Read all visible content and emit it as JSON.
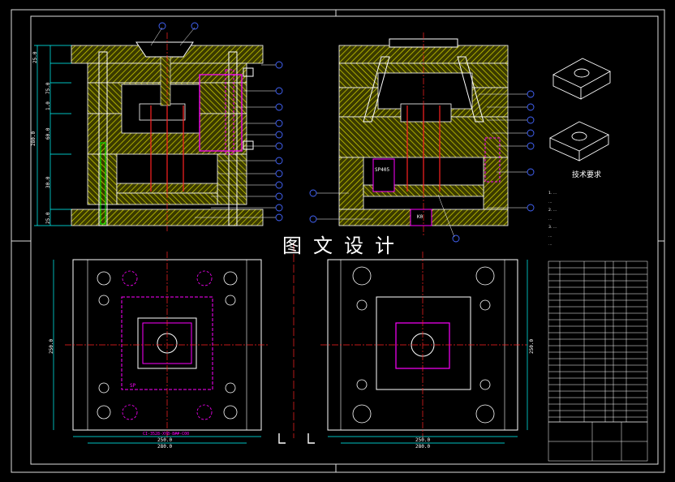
{
  "drawing": {
    "watermark": "图文设计",
    "tech_requirements_title": "技术要求",
    "tech_notes": [
      "1.  ...",
      "   ...",
      "2. ...",
      "   ...",
      "3. ...",
      "   ...",
      "   ..."
    ],
    "front_view": {
      "dims": [
        "25.0",
        "75.0",
        "1.0",
        "60.0",
        "30.0",
        "25.0",
        "280.0"
      ]
    },
    "side_view": {
      "part_labels": [
        "SP405",
        "K0"
      ]
    },
    "bottom_left_plan": {
      "dims": [
        "250.0",
        "280.0",
        "250.0"
      ],
      "labels": [
        "SP",
        "CI-3528-XYB-8##-C00"
      ]
    },
    "bottom_right_plan": {
      "dims": [
        "250.0",
        "280.0",
        "250.0"
      ]
    }
  },
  "colors": {
    "background": "#000000",
    "hatch": "#c8c800",
    "outline": "#ffffff",
    "blue_callout": "#4444ff",
    "magenta": "#ff00ff",
    "cyan": "#00ffff",
    "red_center": "#ff2222",
    "green": "#00ff00"
  }
}
